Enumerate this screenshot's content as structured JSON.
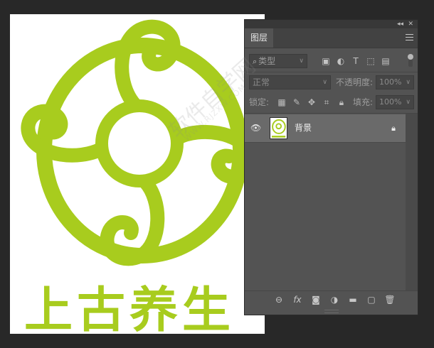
{
  "canvas": {
    "logo_text": "上古养生",
    "logo_color": "#a8cc1e",
    "watermark": "软件自学网",
    "watermark_small": "WWW.RJZXW.COM"
  },
  "panel": {
    "collapse_icon": "collapse-icon",
    "close_icon": "close-icon",
    "tab_label": "图层",
    "menu_icon": "menu-icon",
    "filter": {
      "kind_label": "类型",
      "icons": [
        "image-filter-icon",
        "adjustment-filter-icon",
        "type-filter-icon",
        "shape-filter-icon",
        "smart-object-filter-icon"
      ]
    },
    "blend_mode": "正常",
    "opacity_label": "不透明度:",
    "opacity_value": "100%",
    "lock_label": "锁定:",
    "fill_label": "填充:",
    "fill_value": "100%",
    "lock_icons": [
      "lock-transparent-icon",
      "lock-paint-icon",
      "lock-move-icon",
      "lock-artboard-icon",
      "lock-all-icon"
    ],
    "layers": [
      {
        "name": "背景",
        "visible": true,
        "locked": true
      }
    ],
    "bottom_icons": [
      "link-layers-icon",
      "fx-icon",
      "add-mask-icon",
      "new-adjustment-icon",
      "new-group-icon",
      "new-layer-icon",
      "delete-layer-icon"
    ]
  }
}
